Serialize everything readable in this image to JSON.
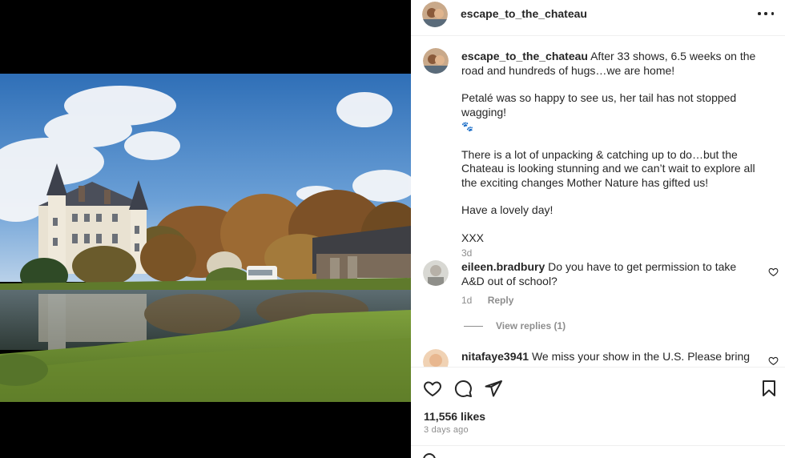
{
  "post": {
    "username": "escape_to_the_chateau",
    "caption": {
      "username": "escape_to_the_chateau",
      "line1": "After 33 shows, 6.5 weeks on the road and hundreds of hugs…we are home!",
      "line2": "Petalé was so happy to see us, her tail has not stopped wagging!",
      "line2_emoji": "🐾",
      "line3": "There is a lot of unpacking & catching up to do…but the Chateau is looking stunning and we can’t wait to explore all the exciting changes Mother Nature has gifted us!",
      "line4": "Have a lovely day!",
      "line5": "XXX",
      "time": "3d"
    },
    "comments": [
      {
        "username": "eileen.bradbury",
        "text": "Do you have to get permission to take A&D out of school?",
        "time": "1d",
        "reply_label": "Reply"
      },
      {
        "username": "nitafaye3941",
        "text": "We miss your show in the U.S. Please bring us more!"
      }
    ],
    "view_replies": "View replies (1)",
    "likes": "11,556 likes",
    "posted_ago": "3 days ago"
  },
  "icons": {
    "more": "more-options-icon",
    "like": "heart-icon",
    "comment": "comment-icon",
    "share": "send-icon",
    "save": "bookmark-icon"
  },
  "colors": {
    "text": "#262626",
    "muted": "#8e8e8e",
    "divider": "#efefef",
    "background": "#ffffff",
    "media_bg": "#000000"
  }
}
